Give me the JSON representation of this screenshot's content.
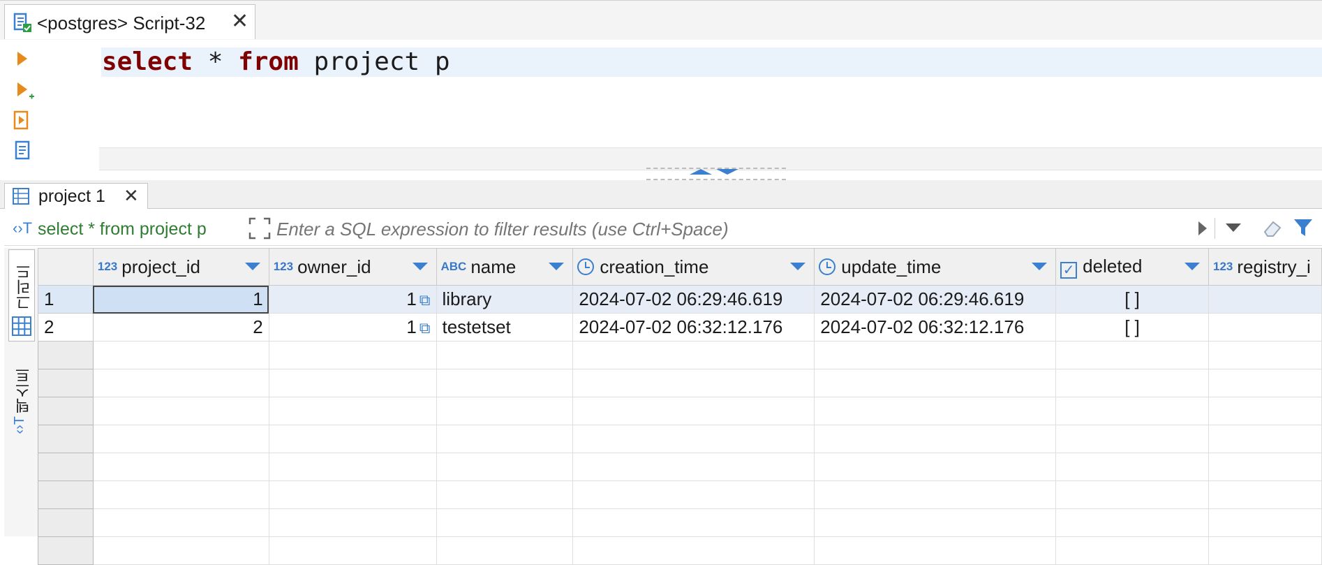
{
  "editor_tab": {
    "title": "<postgres> Script-32"
  },
  "editor": {
    "sql_keyword1": "select",
    "sql_star": " * ",
    "sql_keyword2": "from",
    "sql_rest": " project p"
  },
  "results_tab": {
    "title": "project 1"
  },
  "filter": {
    "query": "select * from project p",
    "placeholder": "Enter a SQL expression to filter results (use Ctrl+Space)"
  },
  "side_tabs": {
    "grid_label": "그리드",
    "text_label": "텍스트"
  },
  "grid": {
    "columns": [
      {
        "type_icon": "123",
        "name": "project_id"
      },
      {
        "type_icon": "123",
        "name": "owner_id"
      },
      {
        "type_icon": "ABC",
        "name": "name"
      },
      {
        "type_icon": "clock-icon",
        "name": "creation_time"
      },
      {
        "type_icon": "clock-icon",
        "name": "update_time"
      },
      {
        "type_icon": "checkbox-icon",
        "name": "deleted"
      },
      {
        "type_icon": "123",
        "name": "registry_i"
      }
    ],
    "rows": [
      {
        "num": "1",
        "project_id": "1",
        "owner_id": "1",
        "name": "library",
        "creation_time": "2024-07-02 06:29:46.619",
        "update_time": "2024-07-02 06:29:46.619",
        "deleted": "[ ]",
        "registry": ""
      },
      {
        "num": "2",
        "project_id": "2",
        "owner_id": "1",
        "name": "testetset",
        "creation_time": "2024-07-02 06:32:12.176",
        "update_time": "2024-07-02 06:32:12.176",
        "deleted": "[ ]",
        "registry": ""
      }
    ]
  },
  "colors": {
    "keyword": "#7f0000",
    "filter_text": "#2e7d32",
    "accent": "#3a7fd0"
  }
}
